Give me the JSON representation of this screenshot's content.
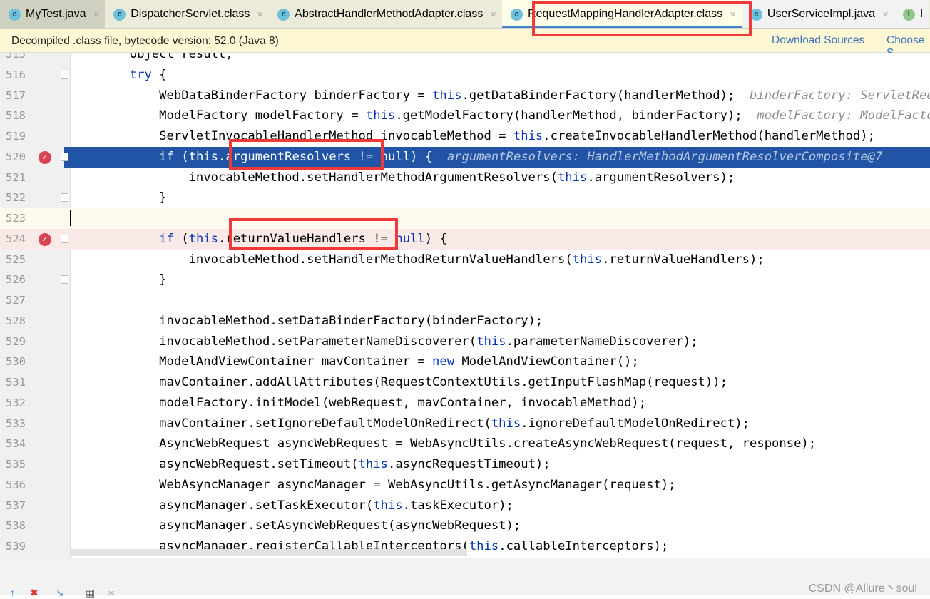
{
  "tabs": [
    {
      "label": "MyTest.java",
      "icon": "java-class-icon",
      "active": false
    },
    {
      "label": "DispatcherServlet.class",
      "icon": "class-icon",
      "active": false
    },
    {
      "label": "AbstractHandlerMethodAdapter.class",
      "icon": "class-icon",
      "active": false
    },
    {
      "label": "RequestMappingHandlerAdapter.class",
      "icon": "class-icon",
      "active": true
    },
    {
      "label": "UserServiceImpl.java",
      "icon": "class-icon",
      "active": false
    },
    {
      "label": "I",
      "icon": "interface-icon",
      "active": false
    }
  ],
  "banner": {
    "message": "Decompiled .class file, bytecode version: 52.0 (Java 8)",
    "download_sources": "Download Sources",
    "choose_sources": "Choose S"
  },
  "code": [
    {
      "n": "515",
      "t": [
        [
          "        Object result;",
          ""
        ]
      ]
    },
    {
      "n": "516",
      "t": [
        [
          "        ",
          ""
        ],
        [
          "try",
          "kw"
        ],
        [
          " {",
          ""
        ]
      ]
    },
    {
      "n": "517",
      "t": [
        [
          "            WebDataBinderFactory binderFactory = ",
          ""
        ],
        [
          "this",
          "kw"
        ],
        [
          ".getDataBinderFactory(handlerMethod);  ",
          ""
        ],
        [
          "binderFactory: ServletRequestDataBinderFactory",
          "hint"
        ]
      ]
    },
    {
      "n": "518",
      "t": [
        [
          "            ModelFactory modelFactory = ",
          ""
        ],
        [
          "this",
          "kw"
        ],
        [
          ".getModelFactory(handlerMethod, binderFactory);  ",
          ""
        ],
        [
          "modelFactory: ModelFactory",
          "hint"
        ]
      ]
    },
    {
      "n": "519",
      "t": [
        [
          "            ServletInvocableHandlerMethod invocableMethod = ",
          ""
        ],
        [
          "this",
          "kw"
        ],
        [
          ".createInvocableHandlerMethod(handlerMethod);",
          ""
        ]
      ]
    },
    {
      "n": "520",
      "t": [
        [
          "            ",
          ""
        ],
        [
          "if",
          "kw"
        ],
        [
          " (",
          ""
        ],
        [
          "this",
          "kw"
        ],
        [
          ".argumentResolvers != ",
          ""
        ],
        [
          "null",
          "kw"
        ],
        [
          ") {  ",
          ""
        ],
        [
          "argumentResolvers: HandlerMethodArgumentResolverComposite@7",
          "hint"
        ]
      ],
      "state": "exec",
      "bp": true
    },
    {
      "n": "521",
      "t": [
        [
          "                invocableMethod.setHandlerMethodArgumentResolvers(",
          ""
        ],
        [
          "this",
          "kw"
        ],
        [
          ".argumentResolvers);",
          ""
        ]
      ]
    },
    {
      "n": "522",
      "t": [
        [
          "            }",
          ""
        ]
      ]
    },
    {
      "n": "523",
      "t": [
        [
          "",
          ""
        ]
      ],
      "state": "cur"
    },
    {
      "n": "524",
      "t": [
        [
          "            ",
          ""
        ],
        [
          "if",
          "kw"
        ],
        [
          " (",
          ""
        ],
        [
          "this",
          "kw"
        ],
        [
          ".returnValueHandlers != ",
          ""
        ],
        [
          "null",
          "kw"
        ],
        [
          ") {",
          ""
        ]
      ],
      "state": "bp",
      "bp": true
    },
    {
      "n": "525",
      "t": [
        [
          "                invocableMethod.setHandlerMethodReturnValueHandlers(",
          ""
        ],
        [
          "this",
          "kw"
        ],
        [
          ".returnValueHandlers);",
          ""
        ]
      ]
    },
    {
      "n": "526",
      "t": [
        [
          "            }",
          ""
        ]
      ]
    },
    {
      "n": "527",
      "t": [
        [
          "",
          ""
        ]
      ]
    },
    {
      "n": "528",
      "t": [
        [
          "            invocableMethod.setDataBinderFactory(binderFactory);",
          ""
        ]
      ]
    },
    {
      "n": "529",
      "t": [
        [
          "            invocableMethod.setParameterNameDiscoverer(",
          ""
        ],
        [
          "this",
          "kw"
        ],
        [
          ".parameterNameDiscoverer);",
          ""
        ]
      ]
    },
    {
      "n": "530",
      "t": [
        [
          "            ModelAndViewContainer mavContainer = ",
          ""
        ],
        [
          "new",
          "kw"
        ],
        [
          " ModelAndViewContainer();",
          ""
        ]
      ]
    },
    {
      "n": "531",
      "t": [
        [
          "            mavContainer.addAllAttributes(RequestContextUtils.getInputFlashMap(request));",
          ""
        ]
      ]
    },
    {
      "n": "532",
      "t": [
        [
          "            modelFactory.initModel(webRequest, mavContainer, invocableMethod);",
          ""
        ]
      ]
    },
    {
      "n": "533",
      "t": [
        [
          "            mavContainer.setIgnoreDefaultModelOnRedirect(",
          ""
        ],
        [
          "this",
          "kw"
        ],
        [
          ".ignoreDefaultModelOnRedirect);",
          ""
        ]
      ]
    },
    {
      "n": "534",
      "t": [
        [
          "            AsyncWebRequest asyncWebRequest = WebAsyncUtils.createAsyncWebRequest(request, response);",
          ""
        ]
      ]
    },
    {
      "n": "535",
      "t": [
        [
          "            asyncWebRequest.setTimeout(",
          ""
        ],
        [
          "this",
          "kw"
        ],
        [
          ".asyncRequestTimeout);",
          ""
        ]
      ]
    },
    {
      "n": "536",
      "t": [
        [
          "            WebAsyncManager asyncManager = WebAsyncUtils.getAsyncManager(request);",
          ""
        ]
      ]
    },
    {
      "n": "537",
      "t": [
        [
          "            asyncManager.setTaskExecutor(",
          ""
        ],
        [
          "this",
          "kw"
        ],
        [
          ".taskExecutor);",
          ""
        ]
      ]
    },
    {
      "n": "538",
      "t": [
        [
          "            asyncManager.setAsyncWebRequest(asyncWebRequest);",
          ""
        ]
      ]
    },
    {
      "n": "539",
      "t": [
        [
          "            asyncManager.registerCallableInterceptors(",
          ""
        ],
        [
          "this",
          "kw"
        ],
        [
          ".callableInterceptors);",
          ""
        ]
      ]
    }
  ],
  "watermark": "CSDN @Allure丶soul",
  "colors": {
    "highlight_box": "#f03a3a",
    "execution_line": "#2154a5",
    "breakpoint_line": "#f9e9e7",
    "keyword": "#0033b3"
  }
}
